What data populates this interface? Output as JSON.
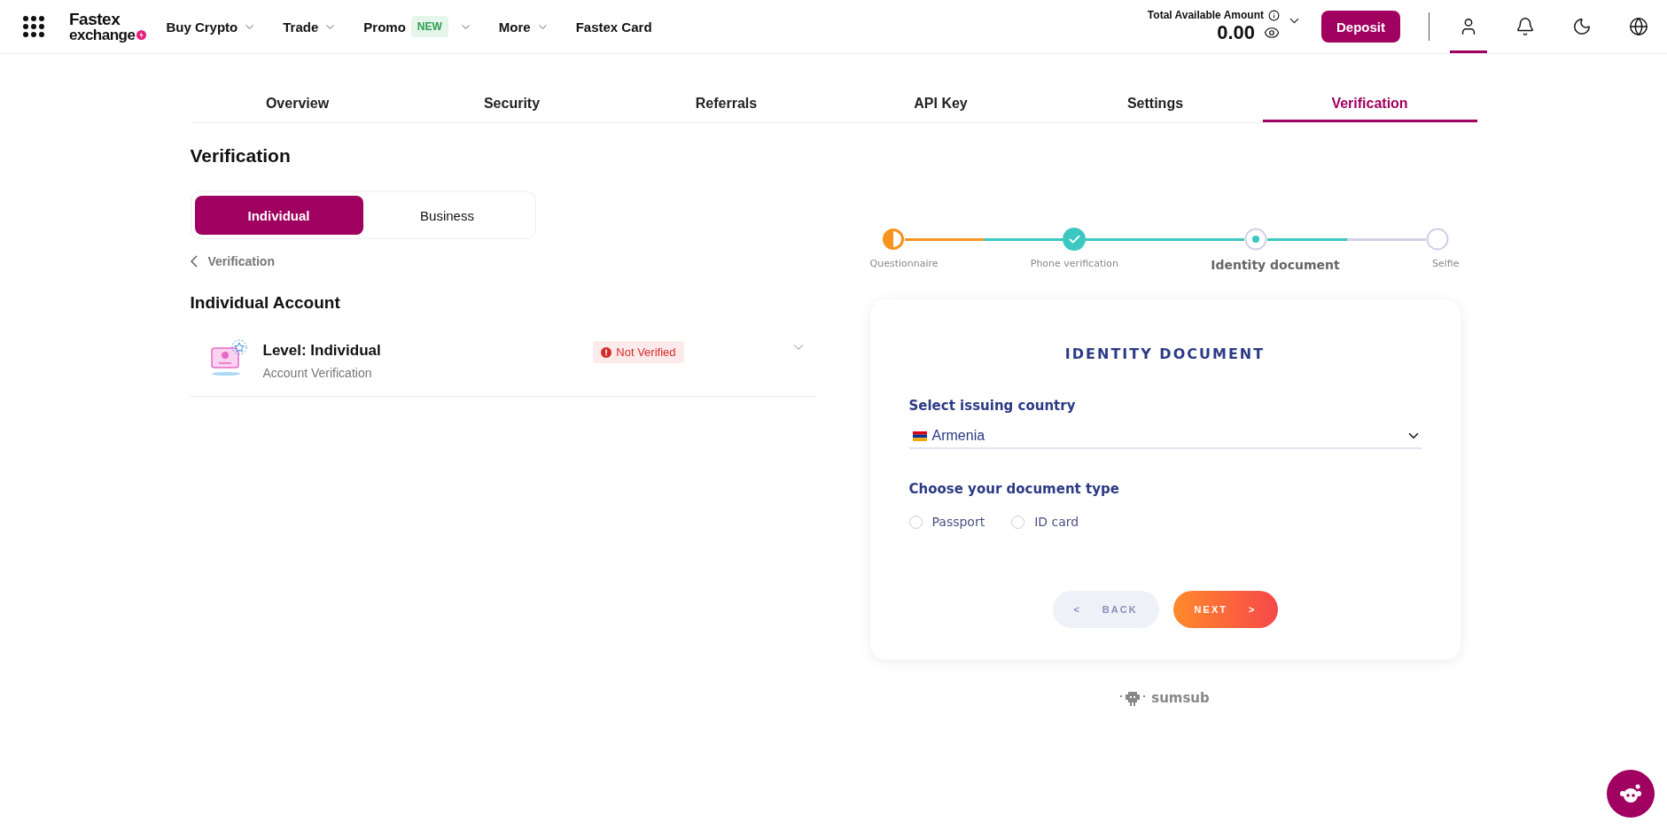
{
  "header": {
    "logo": {
      "line1": "Fastex",
      "line2": "exchange"
    },
    "nav": [
      {
        "label": "Buy Crypto",
        "has_menu": true
      },
      {
        "label": "Trade",
        "has_menu": true
      },
      {
        "label": "Promo",
        "badge": "NEW",
        "has_menu": true
      },
      {
        "label": "More",
        "has_menu": true
      },
      {
        "label": "Fastex Card",
        "has_menu": false
      }
    ],
    "balance": {
      "label": "Total Available Amount",
      "amount": "0.00"
    },
    "deposit": "Deposit",
    "icons": [
      {
        "kind": "user",
        "selected": true
      },
      {
        "kind": "bell",
        "selected": false
      },
      {
        "kind": "moon",
        "selected": false
      },
      {
        "kind": "globe",
        "selected": false
      }
    ]
  },
  "tabs": [
    {
      "label": "Overview",
      "selected": false
    },
    {
      "label": "Security",
      "selected": false
    },
    {
      "label": "Referrals",
      "selected": false
    },
    {
      "label": "API Key",
      "selected": false
    },
    {
      "label": "Settings",
      "selected": false
    },
    {
      "label": "Verification",
      "selected": true
    }
  ],
  "page_title": "Verification",
  "account_types": [
    {
      "label": "Individual",
      "selected": true
    },
    {
      "label": "Business",
      "selected": false
    }
  ],
  "breadcrumb": "Verification",
  "section_title": "Individual Account",
  "level": {
    "title": "Level: Individual",
    "subtitle": "Account Verification",
    "status": "Not Verified",
    "expanded": false
  },
  "stepper": [
    {
      "label": "Questionnaire",
      "kind": "partial"
    },
    {
      "label": "Phone verification",
      "kind": "done"
    },
    {
      "label": "Identity document",
      "kind": "current"
    },
    {
      "label": "Selfie",
      "kind": "todo"
    }
  ],
  "card": {
    "title": "IDENTITY DOCUMENT",
    "country_label": "Select issuing country",
    "country": "Armenia",
    "doc_label": "Choose your document type",
    "doc_types": [
      {
        "label": "Passport",
        "selected": false
      },
      {
        "label": "ID card",
        "selected": false
      }
    ],
    "back": {
      "arrow": "<",
      "label": "BACK"
    },
    "next": {
      "label": "NEXT",
      "arrow": ">"
    }
  },
  "provider": "sumsub"
}
